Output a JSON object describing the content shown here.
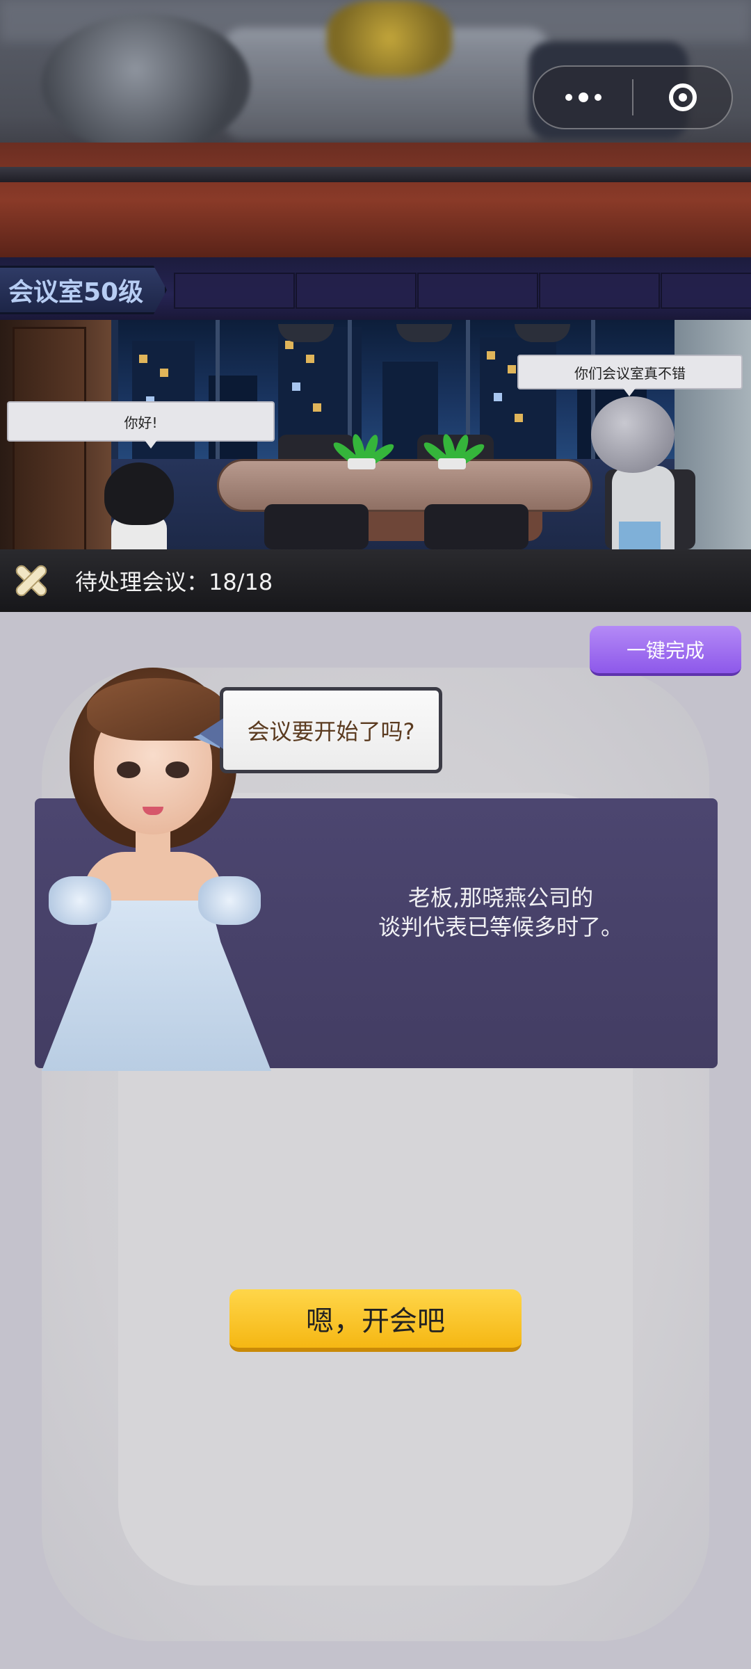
{
  "room": {
    "label": "会议室50级"
  },
  "scene": {
    "bubble_left": "你好!",
    "bubble_right": "你们会议室真不错"
  },
  "header": {
    "pending_label": "待处理会议：18/18"
  },
  "panel": {
    "quick_complete_label": "一键完成",
    "question": "会议要开始了吗?",
    "dialog_lines": [
      "老板,那晓燕公司的",
      "谈判代表已等候多时了。"
    ],
    "confirm_label": "嗯，开会吧"
  },
  "colors": {
    "quick_button": "#9b6cf0",
    "confirm_button": "#f8c21f",
    "dialog_bg": "#48416a",
    "header_bg": "#1e1e22"
  },
  "icons": {
    "capsule_menu": "more-dots-icon",
    "capsule_close": "target-circle-icon",
    "close": "close-x-icon"
  }
}
